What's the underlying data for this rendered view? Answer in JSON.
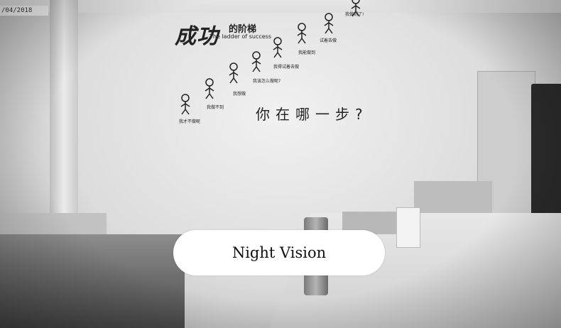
{
  "timestamp": "/04/2018",
  "wall": {
    "title_cn": "成功",
    "title_cn_small": "的阶梯",
    "title_en": "The ladder of success",
    "question": "你在哪一步?",
    "steps": [
      "我才不做呢",
      "我做不到",
      "我想做",
      "我该怎么做呢?",
      "我得试着去做",
      "我能做到",
      "试着去做",
      "我做到了!"
    ]
  },
  "overlay_label": "Night Vision",
  "colors": {
    "pill": "#ffffff",
    "wall": "#e6e6e6"
  }
}
